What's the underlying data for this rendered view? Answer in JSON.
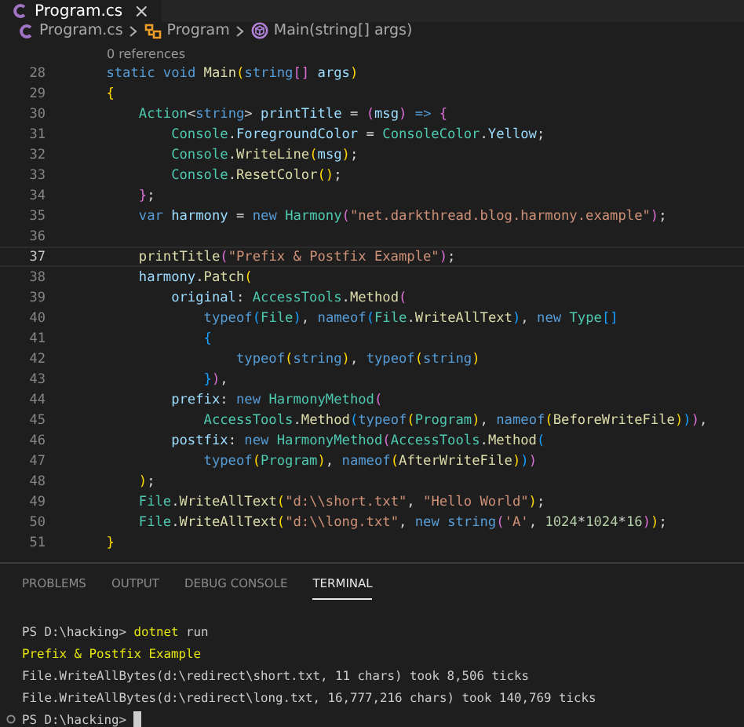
{
  "tabs": [
    {
      "label": "Program.cs",
      "close": "×",
      "selected": true
    }
  ],
  "breadcrumb": [
    {
      "label": "Program.cs",
      "kind": "file"
    },
    {
      "label": "Program",
      "kind": "class"
    },
    {
      "label": "Main(string[] args)",
      "kind": "method"
    }
  ],
  "codelens": "0 references",
  "code_lines": [
    {
      "number": "28",
      "current": false,
      "tokens": [
        {
          "text": "    static",
          "kind": "keyword"
        },
        {
          "text": " void",
          "kind": "keyword"
        },
        {
          "text": " Main",
          "kind": "function"
        },
        {
          "text": "(",
          "kind": "bracket_outer"
        },
        {
          "text": "string",
          "kind": "keyword"
        },
        {
          "text": "[]",
          "kind": "bracket_middle"
        },
        {
          "text": " args",
          "kind": "variable"
        },
        {
          "text": ")",
          "kind": "bracket_outer"
        }
      ]
    },
    {
      "number": "29",
      "current": false,
      "tokens": [
        {
          "text": "    {",
          "kind": "bracket_outer"
        }
      ]
    },
    {
      "number": "30",
      "current": false,
      "tokens": [
        {
          "text": "        Action",
          "kind": "type"
        },
        {
          "text": "<",
          "kind": "punctuation"
        },
        {
          "text": "string",
          "kind": "keyword"
        },
        {
          "text": ">",
          "kind": "punctuation"
        },
        {
          "text": " printTitle",
          "kind": "variable"
        },
        {
          "text": " = ",
          "kind": "punctuation"
        },
        {
          "text": "(",
          "kind": "bracket_middle"
        },
        {
          "text": "msg",
          "kind": "variable"
        },
        {
          "text": ")",
          "kind": "bracket_middle"
        },
        {
          "text": " => ",
          "kind": "keyword"
        },
        {
          "text": "{",
          "kind": "bracket_middle"
        }
      ]
    },
    {
      "number": "31",
      "current": false,
      "tokens": [
        {
          "text": "            Console",
          "kind": "type"
        },
        {
          "text": ".",
          "kind": "punctuation"
        },
        {
          "text": "ForegroundColor",
          "kind": "variable"
        },
        {
          "text": " = ",
          "kind": "punctuation"
        },
        {
          "text": "ConsoleColor",
          "kind": "type"
        },
        {
          "text": ".",
          "kind": "punctuation"
        },
        {
          "text": "Yellow",
          "kind": "variable"
        },
        {
          "text": ";",
          "kind": "punctuation"
        }
      ]
    },
    {
      "number": "32",
      "current": false,
      "tokens": [
        {
          "text": "            Console",
          "kind": "type"
        },
        {
          "text": ".",
          "kind": "punctuation"
        },
        {
          "text": "WriteLine",
          "kind": "function"
        },
        {
          "text": "(",
          "kind": "bracket_outer"
        },
        {
          "text": "msg",
          "kind": "variable"
        },
        {
          "text": ")",
          "kind": "bracket_outer"
        },
        {
          "text": ";",
          "kind": "punctuation"
        }
      ]
    },
    {
      "number": "33",
      "current": false,
      "tokens": [
        {
          "text": "            Console",
          "kind": "type"
        },
        {
          "text": ".",
          "kind": "punctuation"
        },
        {
          "text": "ResetColor",
          "kind": "function"
        },
        {
          "text": "()",
          "kind": "bracket_outer"
        },
        {
          "text": ";",
          "kind": "punctuation"
        }
      ]
    },
    {
      "number": "34",
      "current": false,
      "tokens": [
        {
          "text": "        }",
          "kind": "bracket_middle"
        },
        {
          "text": ";",
          "kind": "punctuation"
        }
      ]
    },
    {
      "number": "35",
      "current": false,
      "tokens": [
        {
          "text": "        var",
          "kind": "keyword"
        },
        {
          "text": " harmony",
          "kind": "variable"
        },
        {
          "text": " = ",
          "kind": "punctuation"
        },
        {
          "text": "new",
          "kind": "keyword"
        },
        {
          "text": " Harmony",
          "kind": "type"
        },
        {
          "text": "(",
          "kind": "bracket_middle"
        },
        {
          "text": "\"net.darkthread.blog.harmony.example\"",
          "kind": "string"
        },
        {
          "text": ")",
          "kind": "bracket_middle"
        },
        {
          "text": ";",
          "kind": "punctuation"
        }
      ]
    },
    {
      "number": "36",
      "current": false
    },
    {
      "number": "37",
      "current": true,
      "tokens": [
        {
          "text": "        printTitle",
          "kind": "function"
        },
        {
          "text": "(",
          "kind": "bracket_middle"
        },
        {
          "text": "\"Prefix & Postfix Example\"",
          "kind": "string"
        },
        {
          "text": ")",
          "kind": "bracket_middle"
        },
        {
          "text": ";",
          "kind": "punctuation"
        }
      ]
    },
    {
      "number": "38",
      "current": false,
      "tokens": [
        {
          "text": "        harmony",
          "kind": "variable"
        },
        {
          "text": ".",
          "kind": "punctuation"
        },
        {
          "text": "Patch",
          "kind": "function"
        },
        {
          "text": "(",
          "kind": "bracket_outer"
        }
      ]
    },
    {
      "number": "39",
      "current": false,
      "tokens": [
        {
          "text": "            original",
          "kind": "variable"
        },
        {
          "text": ": ",
          "kind": "punctuation"
        },
        {
          "text": "AccessTools",
          "kind": "type"
        },
        {
          "text": ".",
          "kind": "punctuation"
        },
        {
          "text": "Method",
          "kind": "function"
        },
        {
          "text": "(",
          "kind": "bracket_middle"
        }
      ]
    },
    {
      "number": "40",
      "current": false,
      "tokens": [
        {
          "text": "                typeof",
          "kind": "keyword"
        },
        {
          "text": "(",
          "kind": "bracket_inner"
        },
        {
          "text": "File",
          "kind": "type"
        },
        {
          "text": ")",
          "kind": "bracket_inner"
        },
        {
          "text": ", ",
          "kind": "punctuation"
        },
        {
          "text": "nameof",
          "kind": "keyword"
        },
        {
          "text": "(",
          "kind": "bracket_inner"
        },
        {
          "text": "File",
          "kind": "type"
        },
        {
          "text": ".",
          "kind": "punctuation"
        },
        {
          "text": "WriteAllText",
          "kind": "function"
        },
        {
          "text": ")",
          "kind": "bracket_inner"
        },
        {
          "text": ", ",
          "kind": "punctuation"
        },
        {
          "text": "new",
          "kind": "keyword"
        },
        {
          "text": " Type",
          "kind": "type"
        },
        {
          "text": "[]",
          "kind": "bracket_inner"
        }
      ]
    },
    {
      "number": "41",
      "current": false,
      "tokens": [
        {
          "text": "                {",
          "kind": "bracket_inner"
        }
      ]
    },
    {
      "number": "42",
      "current": false,
      "tokens": [
        {
          "text": "                    typeof",
          "kind": "keyword"
        },
        {
          "text": "(",
          "kind": "bracket_outer"
        },
        {
          "text": "string",
          "kind": "keyword"
        },
        {
          "text": ")",
          "kind": "bracket_outer"
        },
        {
          "text": ", ",
          "kind": "punctuation"
        },
        {
          "text": "typeof",
          "kind": "keyword"
        },
        {
          "text": "(",
          "kind": "bracket_outer"
        },
        {
          "text": "string",
          "kind": "keyword"
        },
        {
          "text": ")",
          "kind": "bracket_outer"
        }
      ]
    },
    {
      "number": "43",
      "current": false,
      "tokens": [
        {
          "text": "                }",
          "kind": "bracket_inner"
        },
        {
          "text": ")",
          "kind": "bracket_middle"
        },
        {
          "text": ",",
          "kind": "punctuation"
        }
      ]
    },
    {
      "number": "44",
      "current": false,
      "tokens": [
        {
          "text": "            prefix",
          "kind": "variable"
        },
        {
          "text": ": ",
          "kind": "punctuation"
        },
        {
          "text": "new",
          "kind": "keyword"
        },
        {
          "text": " HarmonyMethod",
          "kind": "type"
        },
        {
          "text": "(",
          "kind": "bracket_middle"
        }
      ]
    },
    {
      "number": "45",
      "current": false,
      "tokens": [
        {
          "text": "                AccessTools",
          "kind": "type"
        },
        {
          "text": ".",
          "kind": "punctuation"
        },
        {
          "text": "Method",
          "kind": "function"
        },
        {
          "text": "(",
          "kind": "bracket_inner"
        },
        {
          "text": "typeof",
          "kind": "keyword"
        },
        {
          "text": "(",
          "kind": "bracket_outer"
        },
        {
          "text": "Program",
          "kind": "type"
        },
        {
          "text": ")",
          "kind": "bracket_outer"
        },
        {
          "text": ", ",
          "kind": "punctuation"
        },
        {
          "text": "nameof",
          "kind": "keyword"
        },
        {
          "text": "(",
          "kind": "bracket_outer"
        },
        {
          "text": "BeforeWriteFile",
          "kind": "function"
        },
        {
          "text": ")",
          "kind": "bracket_outer"
        },
        {
          "text": ")",
          "kind": "bracket_inner"
        },
        {
          "text": ")",
          "kind": "bracket_middle"
        },
        {
          "text": ",",
          "kind": "punctuation"
        }
      ]
    },
    {
      "number": "46",
      "current": false,
      "tokens": [
        {
          "text": "            postfix",
          "kind": "variable"
        },
        {
          "text": ": ",
          "kind": "punctuation"
        },
        {
          "text": "new",
          "kind": "keyword"
        },
        {
          "text": " HarmonyMethod",
          "kind": "type"
        },
        {
          "text": "(",
          "kind": "bracket_middle"
        },
        {
          "text": "AccessTools",
          "kind": "type"
        },
        {
          "text": ".",
          "kind": "punctuation"
        },
        {
          "text": "Method",
          "kind": "function"
        },
        {
          "text": "(",
          "kind": "bracket_inner"
        }
      ]
    },
    {
      "number": "47",
      "current": false,
      "tokens": [
        {
          "text": "                typeof",
          "kind": "keyword"
        },
        {
          "text": "(",
          "kind": "bracket_outer"
        },
        {
          "text": "Program",
          "kind": "type"
        },
        {
          "text": ")",
          "kind": "bracket_outer"
        },
        {
          "text": ", ",
          "kind": "punctuation"
        },
        {
          "text": "nameof",
          "kind": "keyword"
        },
        {
          "text": "(",
          "kind": "bracket_outer"
        },
        {
          "text": "AfterWriteFile",
          "kind": "function"
        },
        {
          "text": ")",
          "kind": "bracket_outer"
        },
        {
          "text": ")",
          "kind": "bracket_inner"
        },
        {
          "text": ")",
          "kind": "bracket_middle"
        }
      ]
    },
    {
      "number": "48",
      "current": false,
      "tokens": [
        {
          "text": "        )",
          "kind": "bracket_outer"
        },
        {
          "text": ";",
          "kind": "punctuation"
        }
      ]
    },
    {
      "number": "49",
      "current": false,
      "tokens": [
        {
          "text": "        File",
          "kind": "type"
        },
        {
          "text": ".",
          "kind": "punctuation"
        },
        {
          "text": "WriteAllText",
          "kind": "function"
        },
        {
          "text": "(",
          "kind": "bracket_outer"
        },
        {
          "text": "\"d:\\\\short.txt\"",
          "kind": "string"
        },
        {
          "text": ", ",
          "kind": "punctuation"
        },
        {
          "text": "\"Hello World\"",
          "kind": "string"
        },
        {
          "text": ")",
          "kind": "bracket_outer"
        },
        {
          "text": ";",
          "kind": "punctuation"
        }
      ]
    },
    {
      "number": "50",
      "current": false,
      "tokens": [
        {
          "text": "        File",
          "kind": "type"
        },
        {
          "text": ".",
          "kind": "punctuation"
        },
        {
          "text": "WriteAllText",
          "kind": "function"
        },
        {
          "text": "(",
          "kind": "bracket_outer"
        },
        {
          "text": "\"d:\\\\long.txt\"",
          "kind": "string"
        },
        {
          "text": ", ",
          "kind": "punctuation"
        },
        {
          "text": "new",
          "kind": "keyword"
        },
        {
          "text": " string",
          "kind": "keyword"
        },
        {
          "text": "(",
          "kind": "bracket_middle"
        },
        {
          "text": "'A'",
          "kind": "string"
        },
        {
          "text": ", ",
          "kind": "punctuation"
        },
        {
          "text": "1024",
          "kind": "number"
        },
        {
          "text": "*",
          "kind": "punctuation"
        },
        {
          "text": "1024",
          "kind": "number"
        },
        {
          "text": "*",
          "kind": "punctuation"
        },
        {
          "text": "16",
          "kind": "number"
        },
        {
          "text": ")",
          "kind": "bracket_middle"
        },
        {
          "text": ")",
          "kind": "bracket_outer"
        },
        {
          "text": ";",
          "kind": "punctuation"
        }
      ]
    },
    {
      "number": "51",
      "current": false,
      "tokens": [
        {
          "text": "    }",
          "kind": "bracket_outer"
        }
      ]
    }
  ],
  "panel_tabs": [
    {
      "label": "PROBLEMS",
      "selected": false
    },
    {
      "label": "OUTPUT",
      "selected": false
    },
    {
      "label": "DEBUG CONSOLE",
      "selected": false
    },
    {
      "label": "TERMINAL",
      "selected": true
    }
  ],
  "terminal_lines": [
    {
      "cursor": false,
      "tokens": [
        {
          "text": "PS D:\\hacking> ",
          "kind": "plain"
        },
        {
          "text": "dotnet",
          "kind": "command"
        },
        {
          "text": " run",
          "kind": "plain"
        }
      ]
    },
    {
      "cursor": false,
      "tokens": [
        {
          "text": "Prefix & Postfix Example",
          "kind": "highlight"
        }
      ]
    },
    {
      "cursor": false,
      "tokens": [
        {
          "text": "File.WriteAllBytes(d:\\redirect\\short.txt, 11 chars) took 8,506 ticks",
          "kind": "plain"
        }
      ]
    },
    {
      "cursor": false,
      "tokens": [
        {
          "text": "File.WriteAllBytes(d:\\redirect\\long.txt, 16,777,216 chars) took 140,769 ticks",
          "kind": "plain"
        }
      ]
    },
    {
      "cursor": true,
      "tokens": [
        {
          "text": "PS D:\\hacking> ",
          "kind": "plain"
        }
      ]
    }
  ]
}
